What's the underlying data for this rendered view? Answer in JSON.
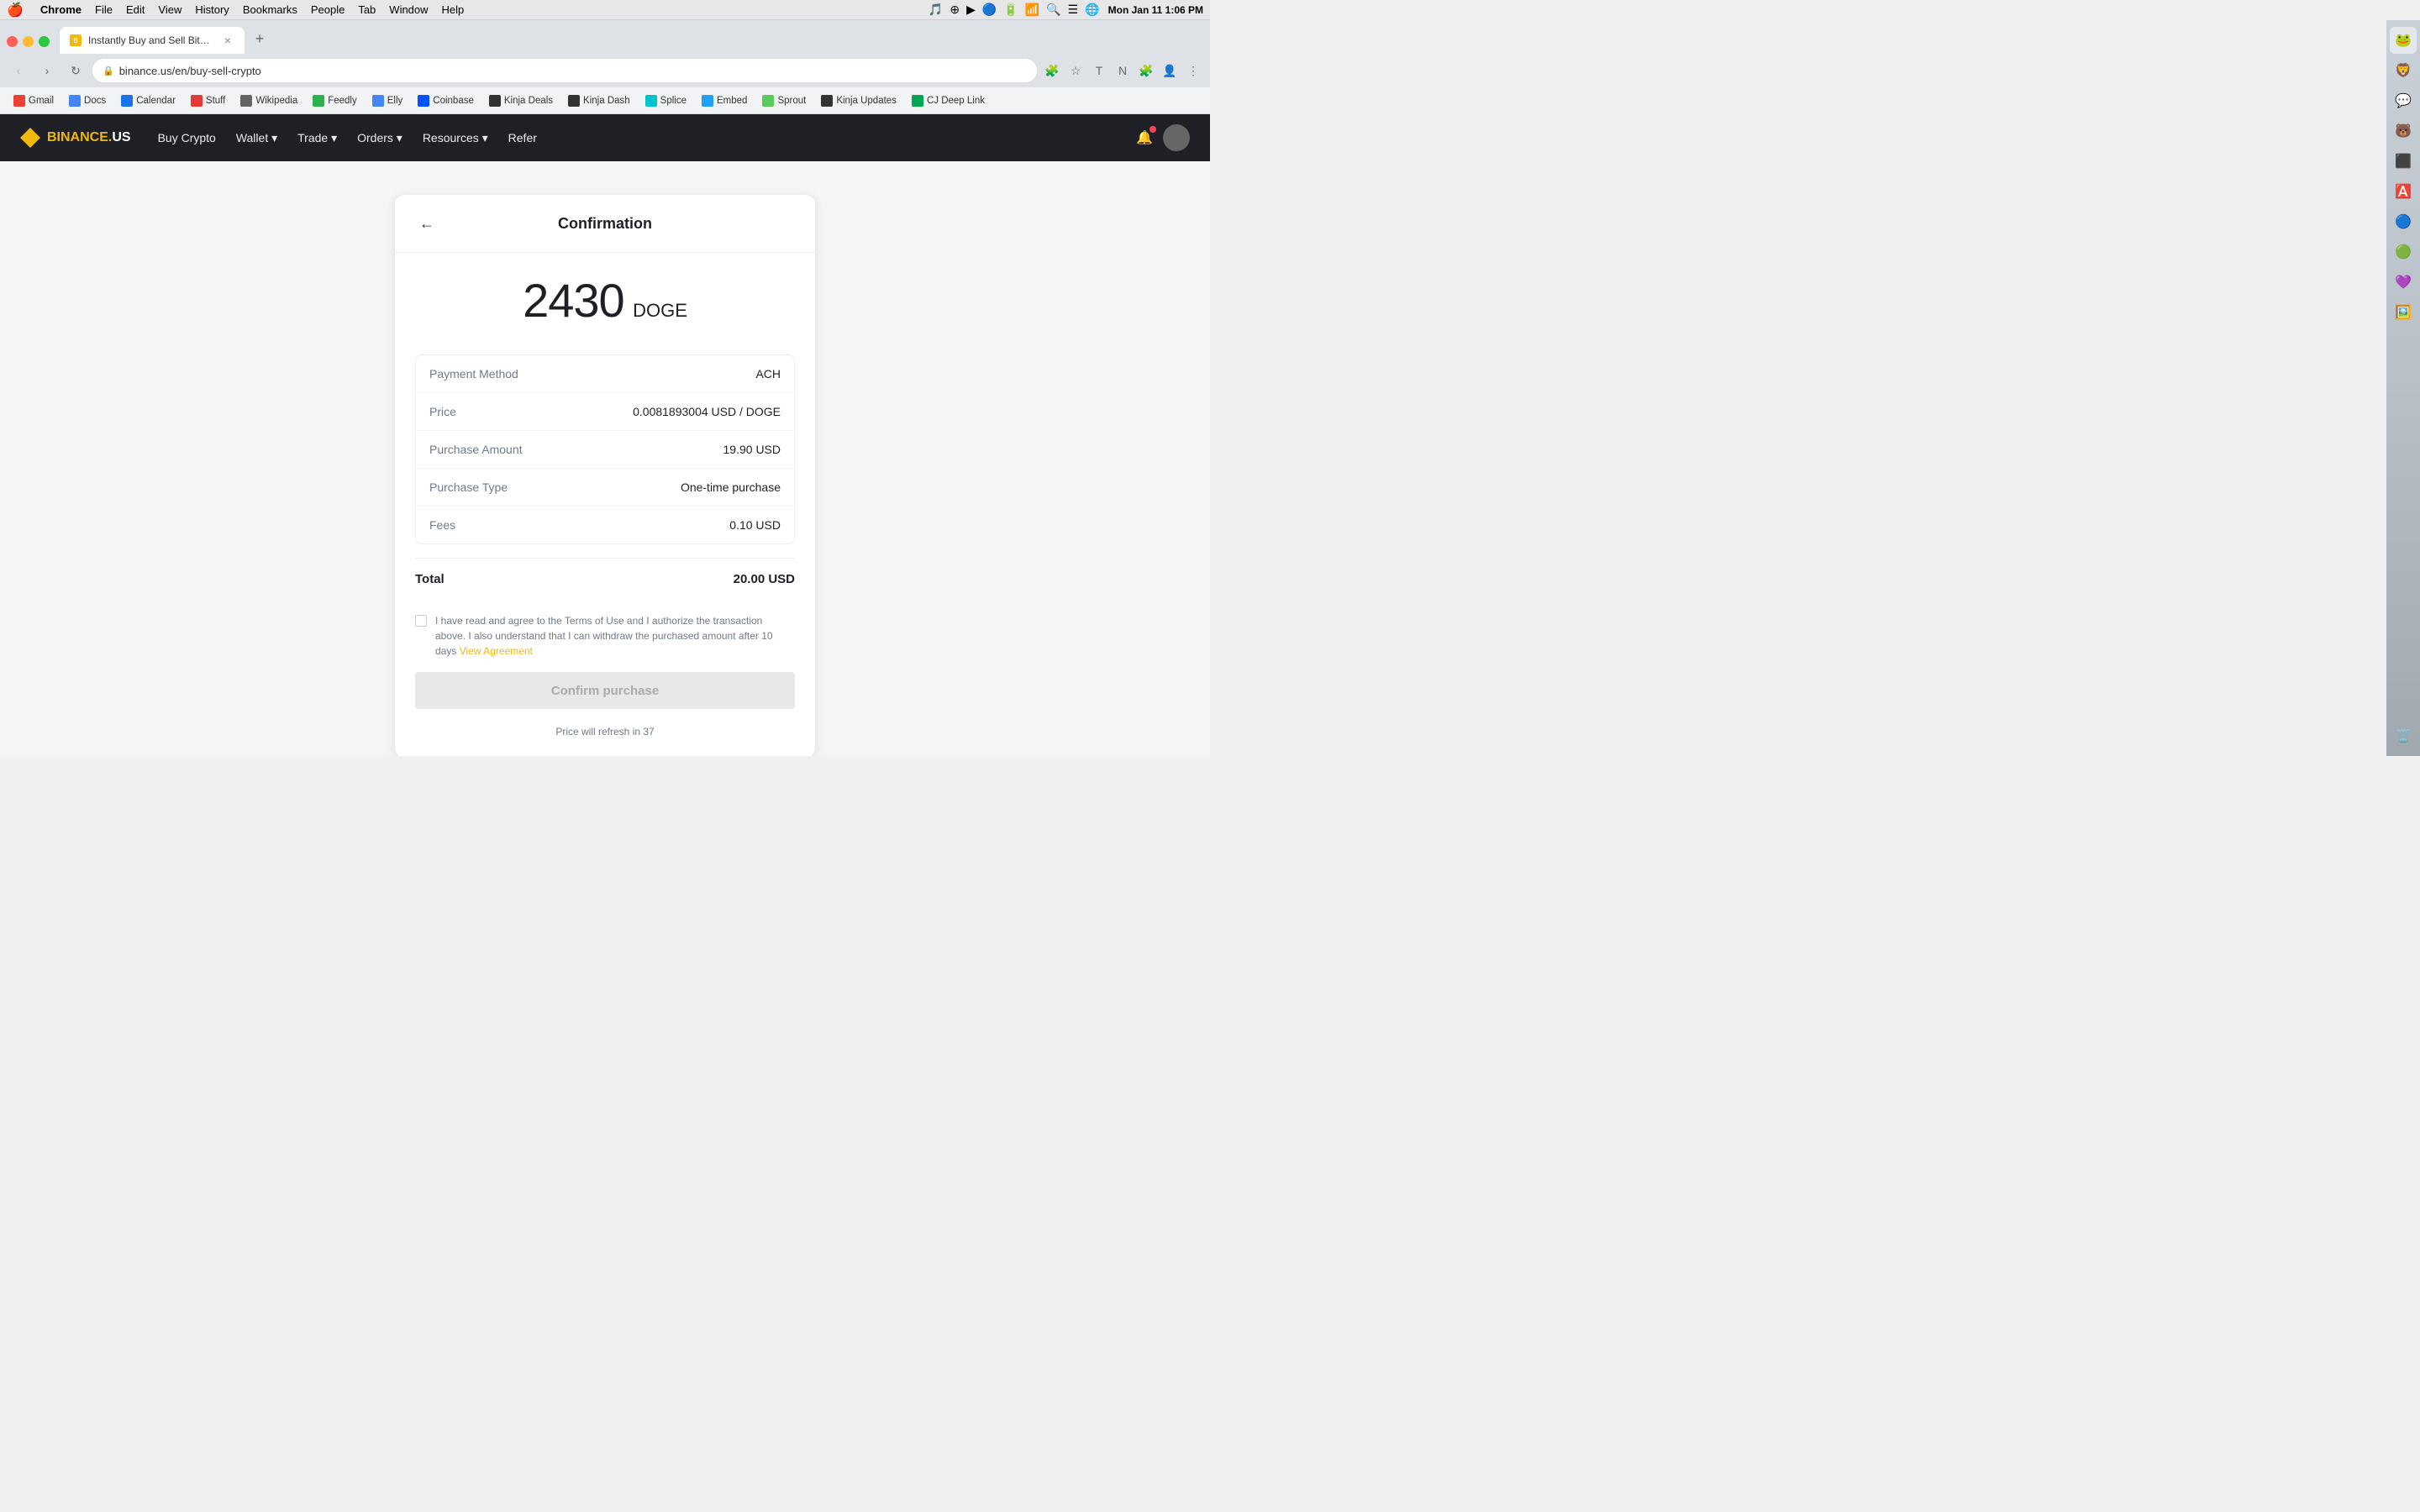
{
  "menubar": {
    "apple": "🍎",
    "items": [
      "Chrome",
      "File",
      "Edit",
      "View",
      "History",
      "Bookmarks",
      "People",
      "Tab",
      "Window",
      "Help"
    ],
    "chrome_bold": "Chrome",
    "time": "Mon Jan 11  1:06 PM"
  },
  "browser": {
    "tab_title": "Instantly Buy and Sell Bitcoin,",
    "tab_favicon": "B",
    "url": "binance.us/en/buy-sell-crypto",
    "new_tab_label": "+"
  },
  "bookmarks": [
    {
      "label": "Gmail",
      "icon": "G",
      "icon_color": "#ea4335"
    },
    {
      "label": "Docs",
      "icon": "D",
      "icon_color": "#4285f4"
    },
    {
      "label": "Calendar",
      "icon": "C",
      "icon_color": "#1a73e8"
    },
    {
      "label": "Stuff",
      "icon": "S",
      "icon_color": "#e53935"
    },
    {
      "label": "Wikipedia",
      "icon": "W",
      "icon_color": "#636466"
    },
    {
      "label": "Feedly",
      "icon": "F",
      "icon_color": "#2bb24c"
    },
    {
      "label": "Elly",
      "icon": "E",
      "icon_color": "#4285f4"
    },
    {
      "label": "Coinbase",
      "icon": "C",
      "icon_color": "#0052ff"
    },
    {
      "label": "Kinja Deals",
      "icon": "K",
      "icon_color": "#333"
    },
    {
      "label": "Kinja Dash",
      "icon": "K",
      "icon_color": "#333"
    },
    {
      "label": "Splice",
      "icon": "S",
      "icon_color": "#00c4cc"
    },
    {
      "label": "Embed",
      "icon": "T",
      "icon_color": "#1da1f2"
    },
    {
      "label": "Sprout",
      "icon": "S",
      "icon_color": "#59cb59"
    },
    {
      "label": "Kinja Updates",
      "icon": "K",
      "icon_color": "#333"
    },
    {
      "label": "CJ Deep Link",
      "icon": "C",
      "icon_color": "#00a651"
    }
  ],
  "binance_nav": {
    "logo_bin": "BIN",
    "logo_ance": "ANCE",
    "logo_dot": ".",
    "logo_us": "US",
    "nav_items": [
      {
        "label": "Buy Crypto",
        "has_arrow": false
      },
      {
        "label": "Wallet",
        "has_arrow": true
      },
      {
        "label": "Trade",
        "has_arrow": true
      },
      {
        "label": "Orders",
        "has_arrow": true
      },
      {
        "label": "Resources",
        "has_arrow": true
      },
      {
        "label": "Refer",
        "has_arrow": false
      }
    ]
  },
  "confirmation": {
    "title": "Confirmation",
    "amount_number": "2430",
    "amount_currency": "DOGE",
    "details": [
      {
        "label": "Payment Method",
        "value": "ACH"
      },
      {
        "label": "Price",
        "value": "0.0081893004 USD / DOGE"
      },
      {
        "label": "Purchase Amount",
        "value": "19.90 USD"
      },
      {
        "label": "Purchase Type",
        "value": "One-time purchase"
      },
      {
        "label": "Fees",
        "value": "0.10 USD"
      }
    ],
    "total_label": "Total",
    "total_value": "20.00 USD",
    "agreement_text": "I have read and agree to the Terms of Use and I authorize the transaction above. I also understand that I can withdraw the purchased amount after 10 days ",
    "agreement_link": "View Agreement",
    "confirm_button": "Confirm purchase",
    "refresh_text": "Price will refresh in 37"
  }
}
